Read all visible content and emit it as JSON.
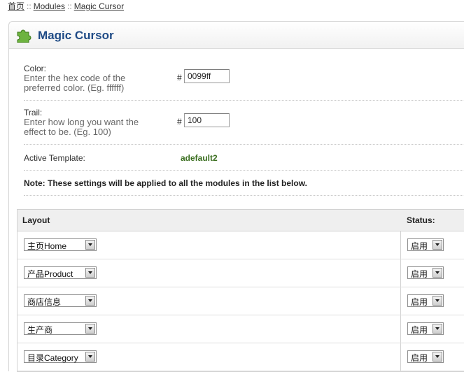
{
  "breadcrumb": {
    "home": "首页",
    "sep": "::",
    "modules": "Modules",
    "current": "Magic Cursor"
  },
  "panel": {
    "title": "Magic Cursor",
    "icon": "puzzle-piece-icon"
  },
  "form": {
    "color": {
      "label": "Color:",
      "help": "Enter the hex code of the preferred color. (Eg. ffffff)",
      "hash": "#",
      "value": "0099ff"
    },
    "trail": {
      "label": "Trail:",
      "help": "Enter how long you want the effect to be. (Eg. 100)",
      "hash": "#",
      "value": "100"
    },
    "template": {
      "label": "Active Template:",
      "value": "adefault2"
    },
    "note": "Note: These settings will be applied to all the modules in the list below."
  },
  "table": {
    "headers": {
      "layout": "Layout",
      "status": "Status:"
    },
    "rows": [
      {
        "layout": "主页Home",
        "status": "启用"
      },
      {
        "layout": "产品Product",
        "status": "启用"
      },
      {
        "layout": "商店信息",
        "status": "启用"
      },
      {
        "layout": "生产商",
        "status": "启用"
      },
      {
        "layout": "目录Category",
        "status": "启用"
      }
    ]
  },
  "colors": {
    "title": "#1f4b86",
    "template_value": "#3a6e1f",
    "icon": "#6db33f"
  }
}
